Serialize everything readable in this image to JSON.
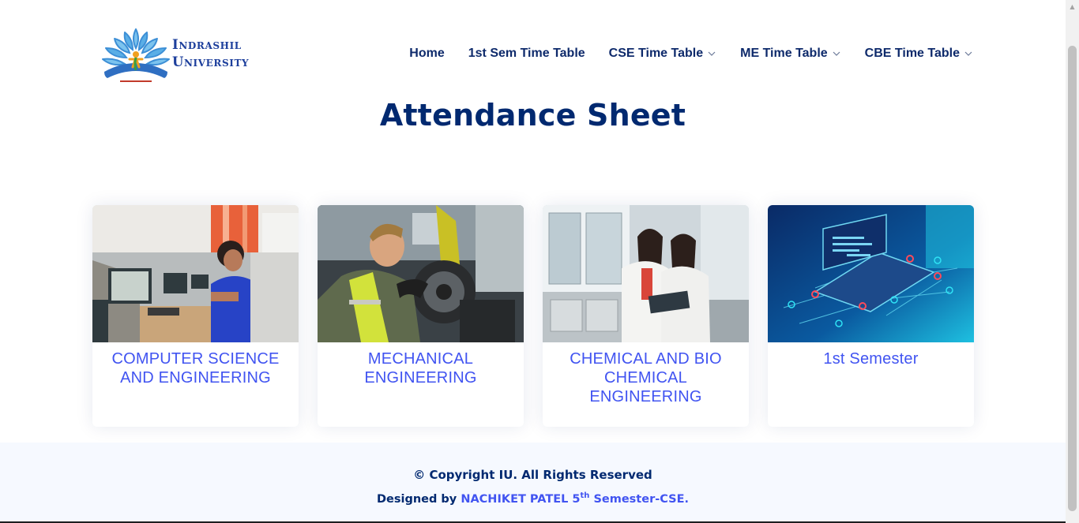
{
  "brand": {
    "line1": "Indrashil",
    "line2": "University",
    "logo_icon": "lotus-figure-logo"
  },
  "nav": {
    "items": [
      {
        "label": "Home",
        "dropdown": false
      },
      {
        "label": "1st Sem Time Table",
        "dropdown": false
      },
      {
        "label": "CSE Time Table",
        "dropdown": true
      },
      {
        "label": "ME Time Table",
        "dropdown": true
      },
      {
        "label": "CBE Time Table",
        "dropdown": true
      }
    ]
  },
  "page": {
    "title": "Attendance Sheet"
  },
  "cards": [
    {
      "title": "COMPUTER SCIENCE AND ENGINEERING",
      "image": "computer-lab-photo"
    },
    {
      "title": "MECHANICAL ENGINEERING",
      "image": "mechanic-engine-photo"
    },
    {
      "title": "CHEMICAL AND BIO CHEMICAL ENGINEERING",
      "image": "chemistry-lab-photo"
    },
    {
      "title": "1st Semester",
      "image": "laptop-network-illustration"
    }
  ],
  "footer": {
    "copyright": "© Copyright IU. All Rights Reserved",
    "designed_prefix": "Designed by ",
    "designer": "NACHIKET PATEL 5",
    "designer_sup": "th",
    "designer_suffix": " Semester-CSE."
  },
  "colors": {
    "navy": "#012970",
    "accent": "#4154f1",
    "footer_bg": "#f6f9ff"
  }
}
